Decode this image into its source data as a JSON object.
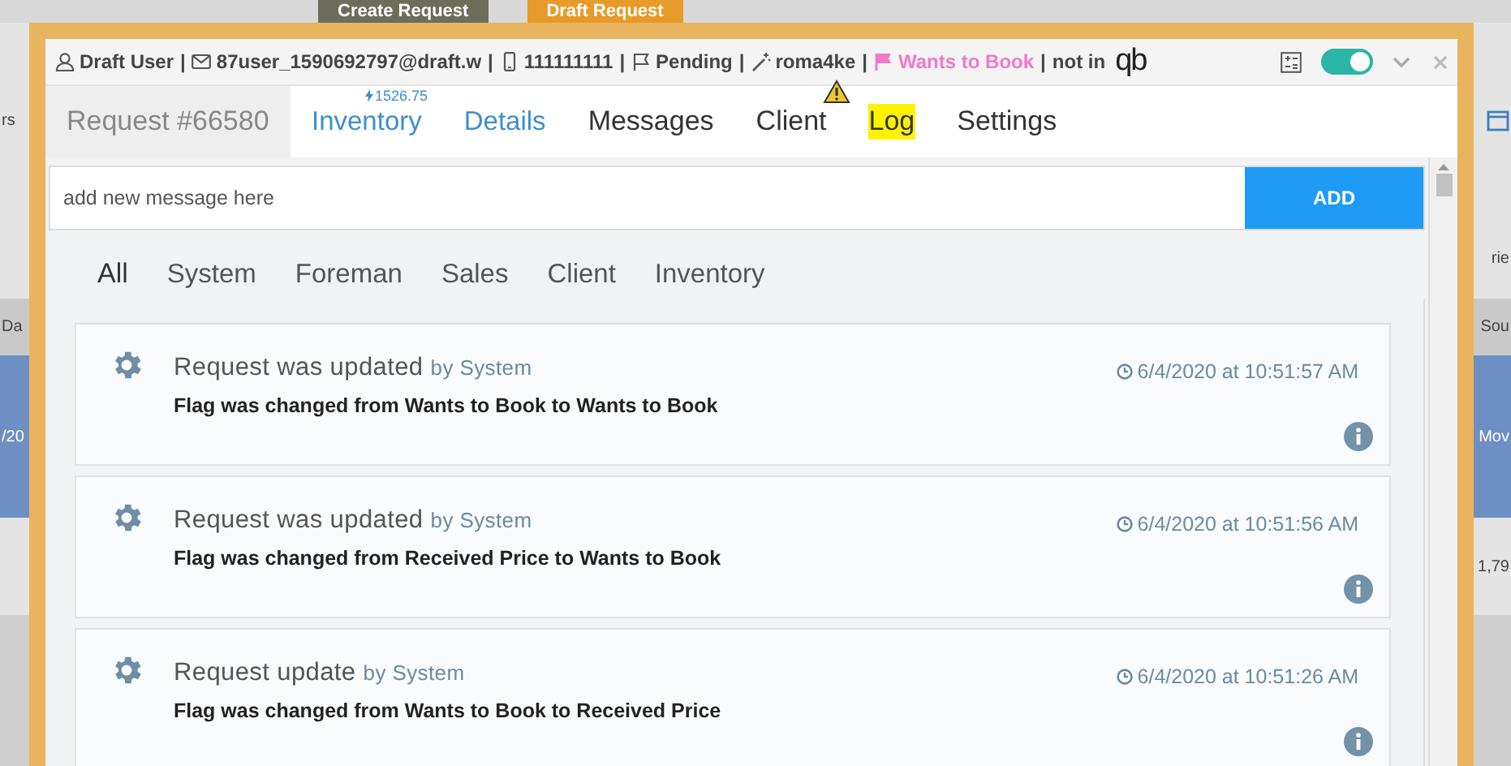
{
  "background": {
    "header_buttons": [
      {
        "label": "Create Request",
        "kind": "dark"
      },
      {
        "label": "Draft Request",
        "kind": "orange"
      }
    ],
    "left_texts": [
      "rs",
      "Da",
      "/20"
    ],
    "right_texts": [
      "rie",
      "Sou",
      "Mov",
      "1,79"
    ]
  },
  "modal": {
    "info_bar": {
      "separator": "|",
      "items": [
        {
          "kind": "user",
          "text": "Draft User"
        },
        {
          "kind": "mail",
          "text": "87user_1590692797@draft.w"
        },
        {
          "kind": "phone",
          "text": "111111111"
        },
        {
          "kind": "flag",
          "text": "Pending"
        },
        {
          "kind": "wand",
          "text": "roma4ke"
        },
        {
          "kind": "pink-flag",
          "text": "Wants to Book"
        },
        {
          "kind": "plain",
          "text": "not in"
        }
      ],
      "logo": "qb",
      "toggle_on": true
    },
    "request_label": "Request #66580",
    "tabs": [
      {
        "label": "Inventory",
        "accent": true,
        "badge": "1526.75",
        "warning": false,
        "selected": false
      },
      {
        "label": "Details",
        "accent": true,
        "warning": false,
        "selected": false
      },
      {
        "label": "Messages",
        "accent": false,
        "warning": false,
        "selected": false
      },
      {
        "label": "Client",
        "accent": false,
        "warning": true,
        "selected": false
      },
      {
        "label": "Log",
        "accent": false,
        "warning": false,
        "selected": true
      },
      {
        "label": "Settings",
        "accent": false,
        "warning": false,
        "selected": false
      }
    ],
    "message_input": {
      "placeholder": "add new message here",
      "button": "ADD"
    },
    "filters": [
      {
        "label": "All",
        "selected": true
      },
      {
        "label": "System",
        "selected": false
      },
      {
        "label": "Foreman",
        "selected": false
      },
      {
        "label": "Sales",
        "selected": false
      },
      {
        "label": "Client",
        "selected": false
      },
      {
        "label": "Inventory",
        "selected": false
      }
    ],
    "log_entries": [
      {
        "title": "Request was updated",
        "by": "by System",
        "time": "6/4/2020 at 10:51:57 AM",
        "detail": "Flag was changed from Wants to Book to Wants to Book"
      },
      {
        "title": "Request was updated",
        "by": "by System",
        "time": "6/4/2020 at 10:51:56 AM",
        "detail": "Flag was changed from Received Price to Wants to Book"
      },
      {
        "title": "Request update",
        "by": "by System",
        "time": "6/4/2020 at 10:51:26 AM",
        "detail": "Flag was changed from Wants to Book to Received Price"
      }
    ]
  }
}
